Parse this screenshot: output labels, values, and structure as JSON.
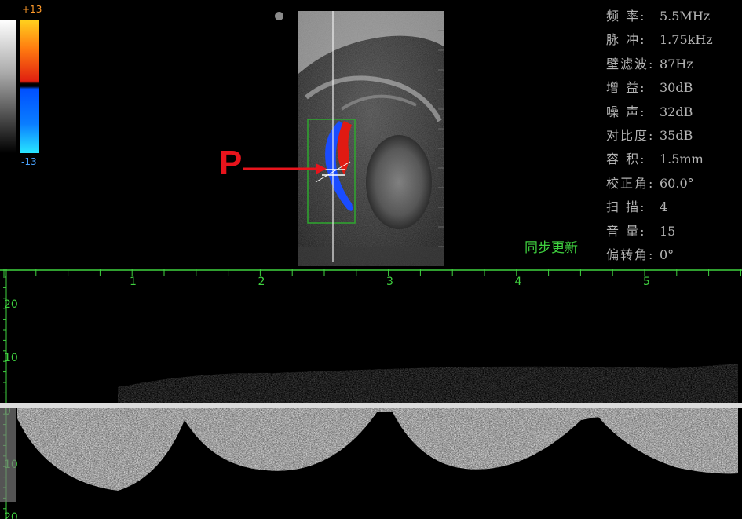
{
  "color_scale": {
    "max_label": "+13",
    "min_label": "-13",
    "colors": {
      "top": "#ffd21e",
      "upper_mid": "#e02010",
      "lower_mid": "#0050ff",
      "bottom": "#28e6ff"
    }
  },
  "annotation": {
    "marker_label": "P",
    "marker_color": "#e8141c"
  },
  "parameters": [
    {
      "name": "频 率",
      "value": "5.5MHz"
    },
    {
      "name": "脉 冲",
      "value": "1.75kHz"
    },
    {
      "name": "壁滤波",
      "value": "87Hz"
    },
    {
      "name": "增 益",
      "value": "30dB"
    },
    {
      "name": "噪 声",
      "value": "32dB"
    },
    {
      "name": "对比度",
      "value": "35dB"
    },
    {
      "name": "容 积",
      "value": "1.5mm"
    },
    {
      "name": "校正角",
      "value": "60.0°"
    },
    {
      "name": "扫 描",
      "value": "4"
    },
    {
      "name": "音 量",
      "value": "15"
    },
    {
      "name": "偏转角",
      "value": "0°"
    }
  ],
  "sync_update_label": "同步更新",
  "spectrum": {
    "time_axis_labels": [
      "1",
      "2",
      "3",
      "4",
      "5"
    ],
    "velocity_axis_labels": [
      "20",
      "10",
      "0",
      "10",
      "20"
    ],
    "axis_color": "#3fd23f"
  }
}
